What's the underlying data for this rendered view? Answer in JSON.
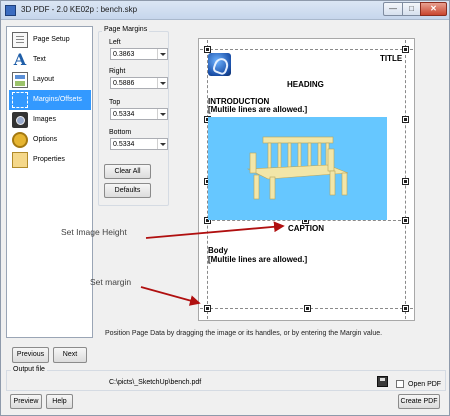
{
  "window": {
    "title": "3D PDF - 2.0 KE02p : bench.skp",
    "minimize_glyph": "—",
    "maximize_glyph": "□",
    "close_glyph": "✕"
  },
  "sidebar": {
    "items": [
      {
        "label": "Page Setup",
        "icon": "page-setup-icon"
      },
      {
        "label": "Text",
        "icon": "text-icon"
      },
      {
        "label": "Layout",
        "icon": "layout-icon"
      },
      {
        "label": "Margins/Offsets",
        "icon": "margins-icon",
        "selected": true
      },
      {
        "label": "Images",
        "icon": "images-icon"
      },
      {
        "label": "Options",
        "icon": "options-icon"
      },
      {
        "label": "Properties",
        "icon": "properties-icon"
      }
    ]
  },
  "margins": {
    "group_label": "Page Margins",
    "left_label": "Left",
    "left_value": "0.3863",
    "right_label": "Right",
    "right_value": "0.5886",
    "top_label": "Top",
    "top_value": "0.5334",
    "bottom_label": "Bottom",
    "bottom_value": "0.5334",
    "clear_all": "Clear All",
    "defaults": "Defaults"
  },
  "preview": {
    "title": "TITLE",
    "heading": "HEADING",
    "intro_title": "INTRODUCTION",
    "intro_note": "[Multile lines are allowed.]",
    "caption": "CAPTION",
    "body_title": "Body",
    "body_note": "[Multile lines are allowed.]",
    "image_bg": "#66c7ff"
  },
  "instruction": "Position Page Data by dragging the image or its handles, or by entering the Margin value.",
  "nav_buttons": {
    "previous": "Previous",
    "next": "Next"
  },
  "output": {
    "group_label": "Output file",
    "path": "C:\\picts\\_SketchUp\\bench.pdf",
    "open_pdf_label": "Open PDF",
    "open_pdf_checked": false
  },
  "footer": {
    "preview": "Preview",
    "help": "Help",
    "create_pdf": "Create PDF"
  },
  "annotations": {
    "image_height": "Set Image Height",
    "margin": "Set margin",
    "arrow_color": "#b00f0f"
  }
}
